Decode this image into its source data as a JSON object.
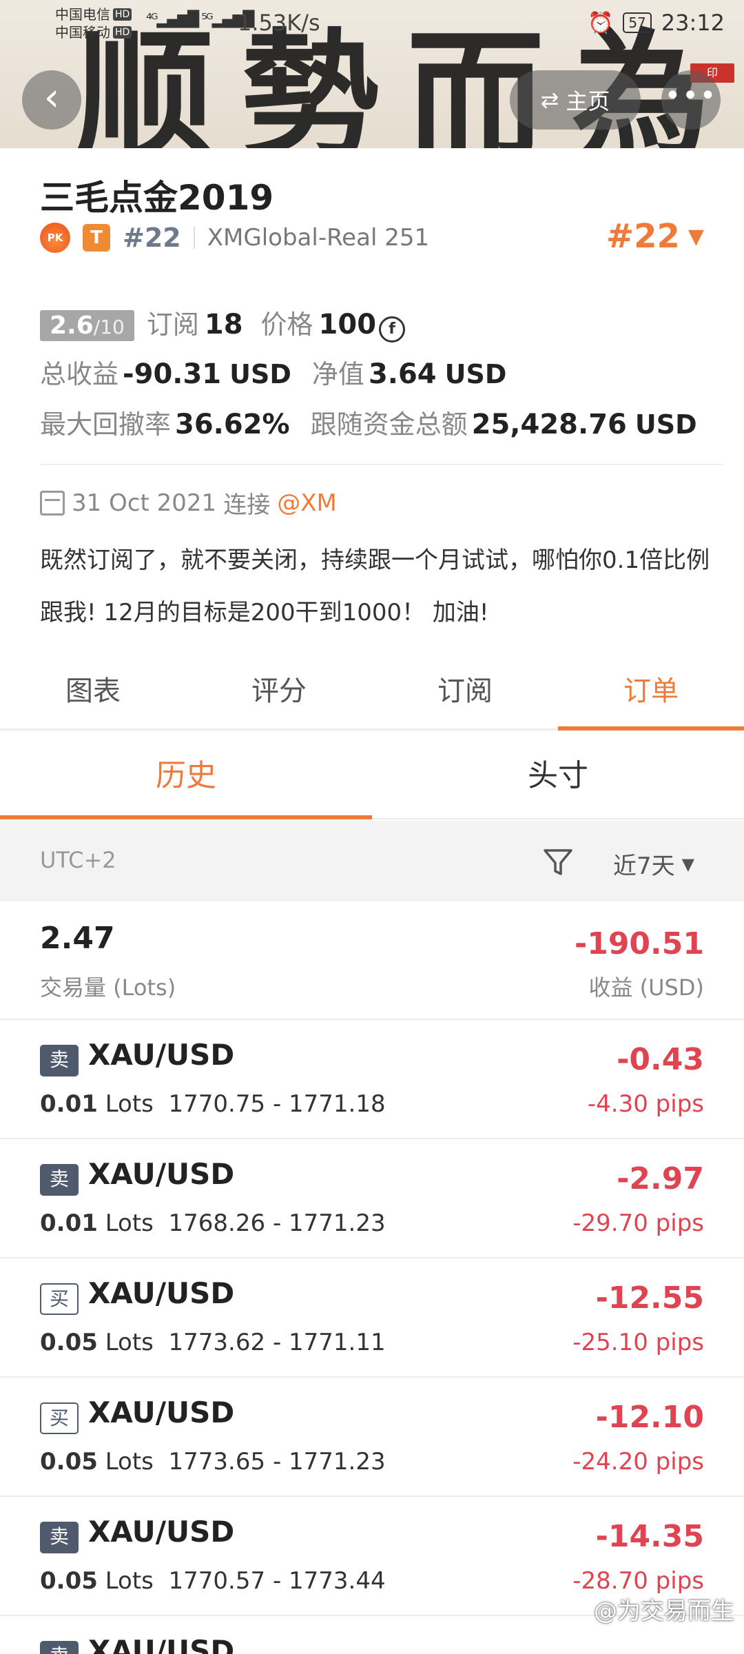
{
  "status_bar": {
    "carrier1": "中国电信",
    "carrier2": "中国移动",
    "hd": "HD",
    "net_speed": "1.53K/s",
    "battery": "57",
    "time": "23:12"
  },
  "header": {
    "banner_text": "顺勢而為",
    "seal_text": "印",
    "home_label": "主页"
  },
  "profile": {
    "name": "三毛点金2019",
    "pk_label": "PK",
    "tier_badge": "T",
    "rank_small": "#22",
    "account": "XMGlobal-Real 251",
    "rank_big": "#22"
  },
  "stats": {
    "rating": "2.6",
    "rating_of": "/10",
    "subs_label": "订阅",
    "subs_value": "18",
    "price_label": "价格",
    "price_value": "100",
    "total_label": "总收益",
    "total_value": "-90.31",
    "total_unit": "USD",
    "equity_label": "净值",
    "equity_value": "3.64",
    "equity_unit": "USD",
    "drawdown_label": "最大回撤率",
    "drawdown_value": "36.62%",
    "follow_label": "跟随资金总额",
    "follow_value": "25,428.76",
    "follow_unit": "USD"
  },
  "connection": {
    "date": "31 Oct 2021",
    "connect_label": "连接",
    "broker": "@XM"
  },
  "bio": "既然订阅了，就不要关闭，持续跟一个月试试，哪怕你0.1倍比例跟我! 12月的目标是200干到1000！ 加油!",
  "tabs": [
    "图表",
    "评分",
    "订阅",
    "订单"
  ],
  "active_tab": "订单",
  "subtabs": [
    "历史",
    "头寸"
  ],
  "filter": {
    "timezone": "UTC+2",
    "range": "近7天"
  },
  "summary": {
    "volume": "2.47",
    "volume_label": "交易量 (Lots)",
    "pnl": "-190.51",
    "pnl_label": "收益 (USD)"
  },
  "orders": [
    {
      "side": "卖",
      "side_type": "sell",
      "symbol": "XAU/USD",
      "lots": "0.01",
      "lots_unit": "Lots",
      "range": "1770.75 - 1771.18",
      "pnl": "-0.43",
      "pips": "-4.30 pips"
    },
    {
      "side": "卖",
      "side_type": "sell",
      "symbol": "XAU/USD",
      "lots": "0.01",
      "lots_unit": "Lots",
      "range": "1768.26 - 1771.23",
      "pnl": "-2.97",
      "pips": "-29.70 pips"
    },
    {
      "side": "买",
      "side_type": "buy",
      "symbol": "XAU/USD",
      "lots": "0.05",
      "lots_unit": "Lots",
      "range": "1773.62 - 1771.11",
      "pnl": "-12.55",
      "pips": "-25.10 pips"
    },
    {
      "side": "买",
      "side_type": "buy",
      "symbol": "XAU/USD",
      "lots": "0.05",
      "lots_unit": "Lots",
      "range": "1773.65 - 1771.23",
      "pnl": "-12.10",
      "pips": "-24.20 pips"
    },
    {
      "side": "卖",
      "side_type": "sell",
      "symbol": "XAU/USD",
      "lots": "0.05",
      "lots_unit": "Lots",
      "range": "1770.57 - 1773.44",
      "pnl": "-14.35",
      "pips": "-28.70 pips"
    },
    {
      "side": "卖",
      "side_type": "sell",
      "symbol": "XAU/USD",
      "lots": "",
      "lots_unit": "",
      "range": "",
      "pnl": "",
      "pips": ""
    }
  ],
  "watermark": "@为交易而生",
  "colors": {
    "accent": "#ef7b3a",
    "loss": "#e04450",
    "sell_badge": "#4f5a6d"
  }
}
